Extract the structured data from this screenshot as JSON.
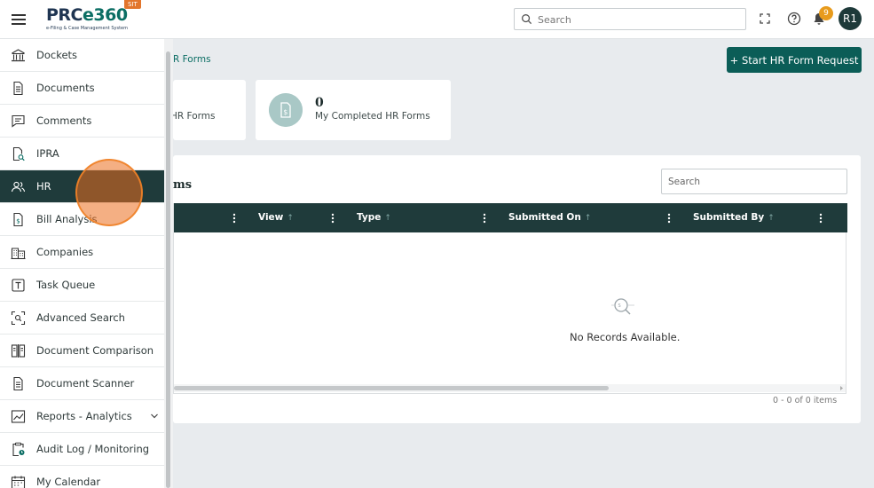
{
  "header": {
    "logo_main_prefix": "PRC",
    "logo_main_accent": "e360",
    "logo_sub": "e-Filing & Case Management System",
    "env_badge": "SIT",
    "search_placeholder": "Search",
    "notification_count": "9",
    "avatar_initials": "R1"
  },
  "sidebar": {
    "items": [
      {
        "label": "Dockets",
        "icon": "bank-icon"
      },
      {
        "label": "Documents",
        "icon": "document-icon"
      },
      {
        "label": "Comments",
        "icon": "comment-icon"
      },
      {
        "label": "IPRA",
        "icon": "document-search-icon"
      },
      {
        "label": "HR",
        "icon": "users-icon",
        "active": true
      },
      {
        "label": "Bill Analysis",
        "icon": "bill-icon"
      },
      {
        "label": "Companies",
        "icon": "building-icon"
      },
      {
        "label": "Task Queue",
        "icon": "task-icon"
      },
      {
        "label": "Advanced Search",
        "icon": "scan-search-icon"
      },
      {
        "label": "Document Comparison",
        "icon": "compare-icon"
      },
      {
        "label": "Document Scanner",
        "icon": "scanner-icon"
      },
      {
        "label": "Reports - Analytics",
        "icon": "chart-icon",
        "expandable": true
      },
      {
        "label": "Audit Log / Monitoring",
        "icon": "clipboard-clock-icon"
      },
      {
        "label": "My Calendar",
        "icon": "calendar-icon"
      }
    ]
  },
  "main": {
    "breadcrumb": "R Forms",
    "start_button": "+ Start HR Form Request",
    "card1_label": "HR Forms",
    "card2_count": "0",
    "card2_label": "My Completed HR Forms",
    "panel_title": "ms",
    "grid_search_placeholder": "Search",
    "columns": [
      "View",
      "Type",
      "Submitted On",
      "Submitted By"
    ],
    "empty_text": "No Records Available.",
    "pager": "0 - 0 of 0 items"
  },
  "colors": {
    "primary": "#0b5d57",
    "nav_active": "#1f3b3b",
    "grid_header": "#1f3b3b",
    "badge": "#e89b1c",
    "env_badge": "#e2762d"
  }
}
